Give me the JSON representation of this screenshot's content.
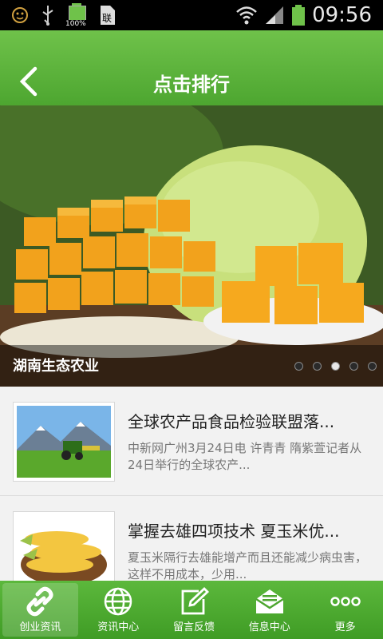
{
  "status": {
    "time": "09:56",
    "battery_text": "100%",
    "icons": [
      "notification-icon",
      "usb-icon",
      "battery-full-icon",
      "sim-icon",
      "wifi-icon",
      "signal-icon",
      "battery-icon"
    ]
  },
  "header": {
    "title": "点击排行",
    "back_icon": "chevron-left-icon"
  },
  "banner": {
    "caption": "湖南生态农业",
    "slides": 5,
    "active_slide": 3
  },
  "articles": [
    {
      "title": "全球农产品食品检验联盟落...",
      "desc": "中新网广州3月24日电 许青青 隋紫萱记者从24日举行的全球农产..."
    },
    {
      "title": "掌握去雄四项技术 夏玉米优...",
      "desc": "夏玉米隔行去雄能增产而且还能减少病虫害，这样不用成本，少用..."
    }
  ],
  "tabs": [
    {
      "label": "创业资讯",
      "icon": "link-icon",
      "active": true
    },
    {
      "label": "资讯中心",
      "icon": "globe-icon",
      "active": false
    },
    {
      "label": "留言反馈",
      "icon": "edit-icon",
      "active": false
    },
    {
      "label": "信息中心",
      "icon": "mail-icon",
      "active": false
    },
    {
      "label": "更多",
      "icon": "more-icon",
      "active": false
    }
  ],
  "colors": {
    "brand_green": "#4da630",
    "status_bar": "#000000"
  }
}
